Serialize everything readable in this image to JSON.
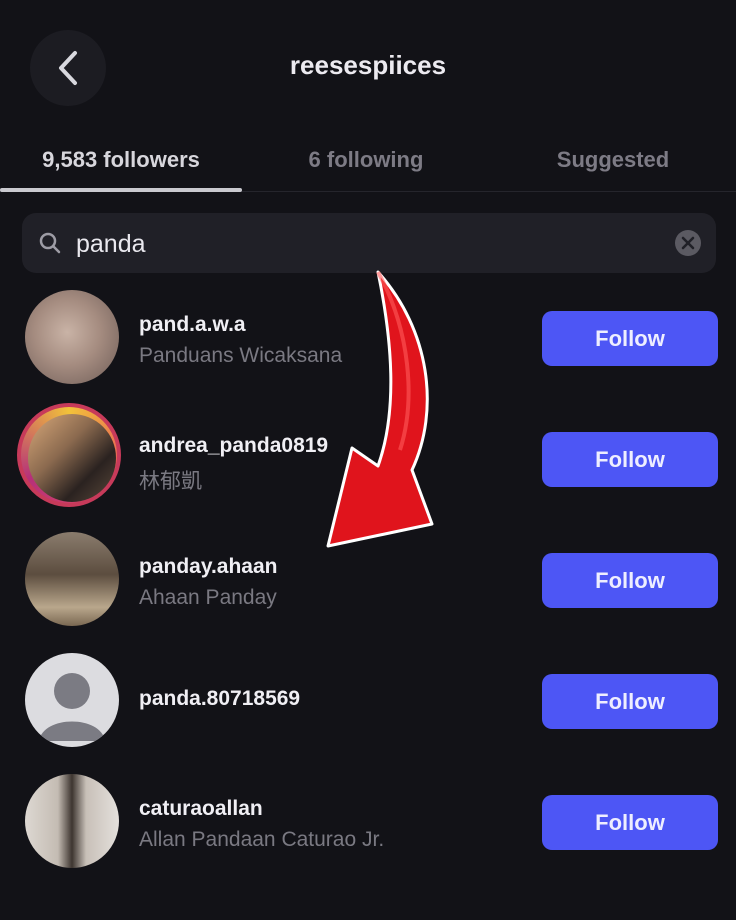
{
  "header": {
    "title": "reesespiices"
  },
  "tabs": [
    {
      "label": "9,583 followers"
    },
    {
      "label": "6 following"
    },
    {
      "label": "Suggested"
    }
  ],
  "search": {
    "value": "panda"
  },
  "results": [
    {
      "username": "pand.a.w.a",
      "fullname": "Panduans Wicaksana",
      "button": "Follow"
    },
    {
      "username": "andrea_panda0819",
      "fullname": "林郁凱",
      "button": "Follow"
    },
    {
      "username": "panday.ahaan",
      "fullname": "Ahaan Panday",
      "button": "Follow"
    },
    {
      "username": "panda.80718569",
      "fullname": "",
      "button": "Follow"
    },
    {
      "username": "caturaoallan",
      "fullname": "Allan Pandaan Caturao Jr.",
      "button": "Follow"
    }
  ],
  "colors": {
    "accent": "#4d56f5",
    "background": "#121217",
    "arrow": "#e0141c"
  }
}
